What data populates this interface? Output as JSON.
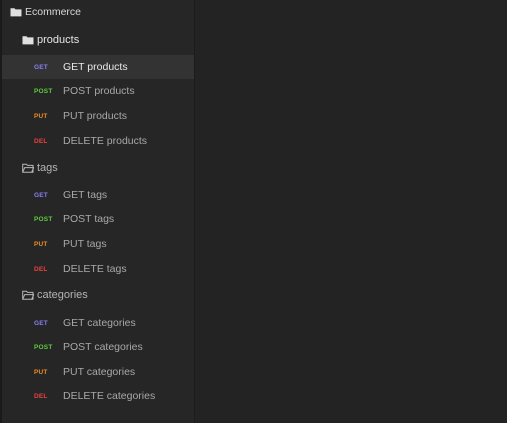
{
  "colors": {
    "get": "#8a7ff0",
    "post": "#5ccd3b",
    "put": "#f08a24",
    "del": "#e8433a",
    "folder_root": "#e0e0e0",
    "folder": "#b8b8b8"
  },
  "collection": {
    "name": "Ecommerce",
    "icon": "folder-filled-icon"
  },
  "folders": [
    {
      "name": "products",
      "icon": "folder-filled-icon",
      "requests": [
        {
          "method": "GET",
          "label": "GET products",
          "selected": true
        },
        {
          "method": "POST",
          "label": "POST products"
        },
        {
          "method": "PUT",
          "label": "PUT products"
        },
        {
          "method": "DEL",
          "label": "DELETE products"
        }
      ]
    },
    {
      "name": "tags",
      "icon": "folder-open-icon",
      "requests": [
        {
          "method": "GET",
          "label": "GET tags"
        },
        {
          "method": "POST",
          "label": "POST tags"
        },
        {
          "method": "PUT",
          "label": "PUT tags"
        },
        {
          "method": "DEL",
          "label": "DELETE tags"
        }
      ]
    },
    {
      "name": "categories",
      "icon": "folder-open-icon",
      "requests": [
        {
          "method": "GET",
          "label": "GET categories"
        },
        {
          "method": "POST",
          "label": "POST categories"
        },
        {
          "method": "PUT",
          "label": "PUT categories"
        },
        {
          "method": "DEL",
          "label": "DELETE categories"
        }
      ]
    }
  ]
}
